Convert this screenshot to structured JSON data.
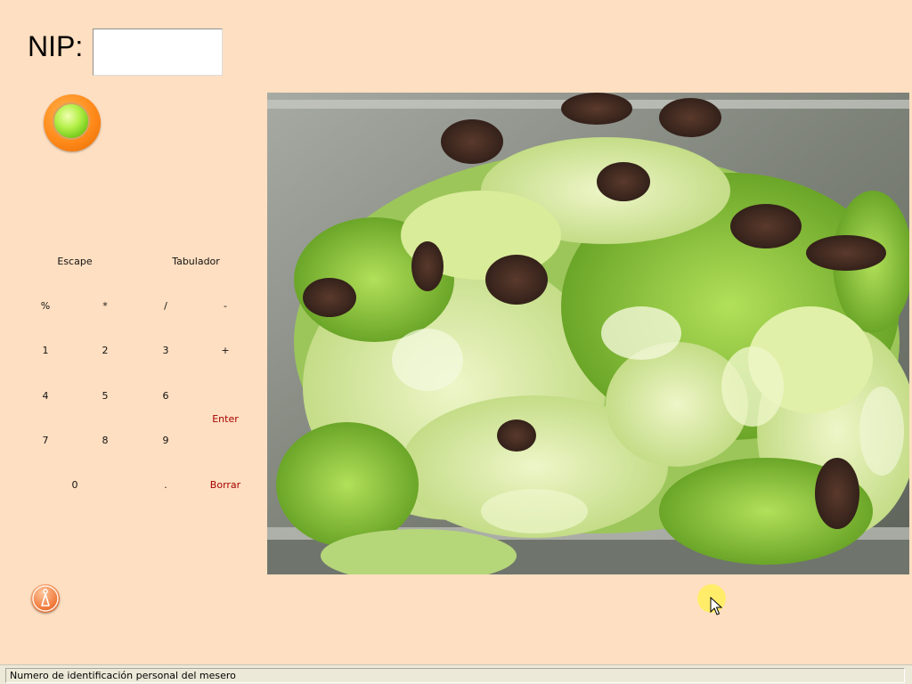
{
  "login": {
    "nip_label": "NIP:",
    "nip_value": ""
  },
  "status_indicator": {
    "icon": "green-light-icon",
    "color": "#7ad21c"
  },
  "keypad": {
    "escape": "Escape",
    "tab": "Tabulador",
    "percent": "%",
    "multiply": "*",
    "divide": "/",
    "minus": "-",
    "k1": "1",
    "k2": "2",
    "k3": "3",
    "plus": "+",
    "k4": "4",
    "k5": "5",
    "k6": "6",
    "enter": "Enter",
    "k7": "7",
    "k8": "8",
    "k9": "9",
    "k0": "0",
    "dot": ".",
    "delete": "Borrar"
  },
  "photo": {
    "subject": "salad-lettuce-photo"
  },
  "info_button": {
    "icon": "info-icon"
  },
  "status_bar": {
    "text": "Numero de identificación personal del mesero"
  },
  "colors": {
    "background": "#ffdfc1",
    "accent_red": "#a50000",
    "orange": "#ff8a1a"
  }
}
